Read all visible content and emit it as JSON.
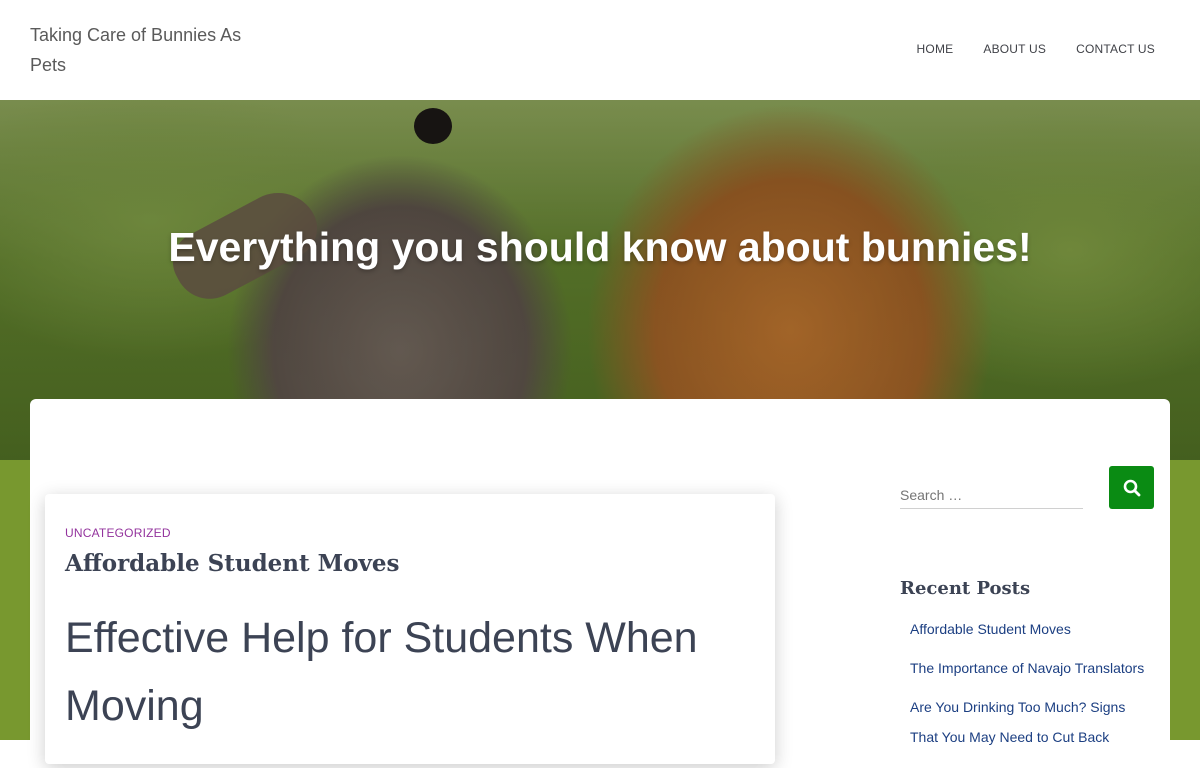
{
  "site": {
    "title": "Taking Care of Bunnies As Pets"
  },
  "nav": {
    "items": [
      {
        "label": "HOME"
      },
      {
        "label": "ABOUT US"
      },
      {
        "label": "CONTACT US"
      }
    ]
  },
  "hero": {
    "title": "Everything you should know about bunnies!"
  },
  "post": {
    "category": "UNCATEGORIZED",
    "title": "Affordable Student Moves",
    "heading": "Effective Help for Students When Moving"
  },
  "sidebar": {
    "search": {
      "placeholder": "Search …"
    },
    "recent_posts": {
      "title": "Recent Posts",
      "items": [
        {
          "label": "Affordable Student Moves"
        },
        {
          "label": "The Importance of Navajo Translators"
        },
        {
          "label": "Are You Drinking Too Much? Signs"
        },
        {
          "label": "That You May Need to Cut Back"
        }
      ]
    }
  },
  "colors": {
    "accent_green": "#0a8b13",
    "band_green": "#78982f",
    "category_purple": "#93339d",
    "link_blue": "#1c3f82"
  },
  "icons": {
    "search_button": "search-icon"
  }
}
